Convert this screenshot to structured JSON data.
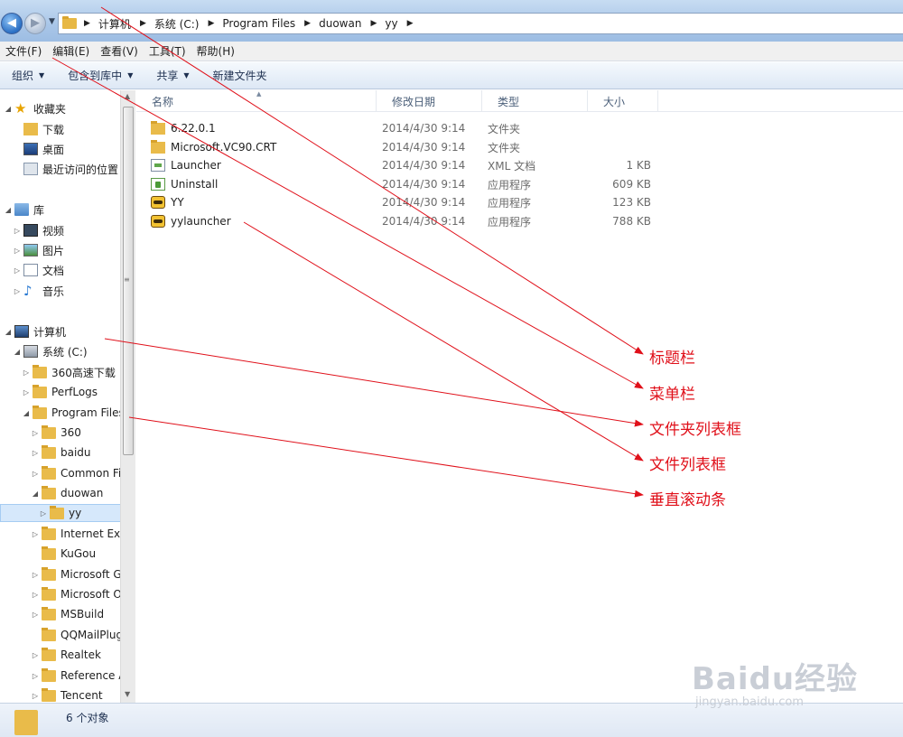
{
  "addressbar": {
    "crumbs": [
      "计算机",
      "系统 (C:)",
      "Program Files",
      "duowan",
      "yy"
    ]
  },
  "menubar": {
    "items": [
      "文件(F)",
      "编辑(E)",
      "查看(V)",
      "工具(T)",
      "帮助(H)"
    ]
  },
  "toolbar": {
    "organize": "组织",
    "include_library": "包含到库中",
    "share": "共享",
    "new_folder": "新建文件夹"
  },
  "navpane": {
    "favorites": "收藏夹",
    "favorites_items": [
      "下载",
      "桌面",
      "最近访问的位置"
    ],
    "libraries": "库",
    "libraries_items": [
      "视频",
      "图片",
      "文档",
      "音乐"
    ],
    "computer": "计算机",
    "drive": "系统 (C:)",
    "drive_items": [
      "360高速下载",
      "PerfLogs",
      "Program Files"
    ],
    "program_files_items": [
      "360",
      "baidu",
      "Common Fil",
      "duowan"
    ],
    "selected": "yy",
    "more_items": [
      "Internet Exp",
      "KuGou",
      "Microsoft G",
      "Microsoft O",
      "MSBuild",
      "QQMailPlug",
      "Realtek",
      "Reference A",
      "Tencent"
    ]
  },
  "filelist": {
    "columns": [
      "名称",
      "修改日期",
      "类型",
      "大小"
    ],
    "rows": [
      {
        "name": "6.22.0.1",
        "date": "2014/4/30 9:14",
        "type": "文件夹",
        "size": "",
        "icon": "folder-icon"
      },
      {
        "name": "Microsoft.VC90.CRT",
        "date": "2014/4/30 9:14",
        "type": "文件夹",
        "size": "",
        "icon": "folder-icon"
      },
      {
        "name": "Launcher",
        "date": "2014/4/30 9:14",
        "type": "XML 文档",
        "size": "1 KB",
        "icon": "xml-file-icon"
      },
      {
        "name": "Uninstall",
        "date": "2014/4/30 9:14",
        "type": "应用程序",
        "size": "609 KB",
        "icon": "uninstall-app-icon"
      },
      {
        "name": "YY",
        "date": "2014/4/30 9:14",
        "type": "应用程序",
        "size": "123 KB",
        "icon": "yy-app-icon"
      },
      {
        "name": "yylauncher",
        "date": "2014/4/30 9:14",
        "type": "应用程序",
        "size": "788 KB",
        "icon": "yy-app-icon"
      }
    ]
  },
  "statusbar": {
    "text": "6 个对象"
  },
  "annotations": {
    "title_bar": "标题栏",
    "menu_bar": "菜单栏",
    "folder_list": "文件夹列表框",
    "file_list": "文件列表框",
    "v_scrollbar": "垂直滚动条"
  },
  "watermark": {
    "brand": "Baidu经验",
    "url": "jingyan.baidu.com"
  },
  "colors": {
    "annotation": "#e0101a",
    "selection": "#d6e8fb"
  }
}
